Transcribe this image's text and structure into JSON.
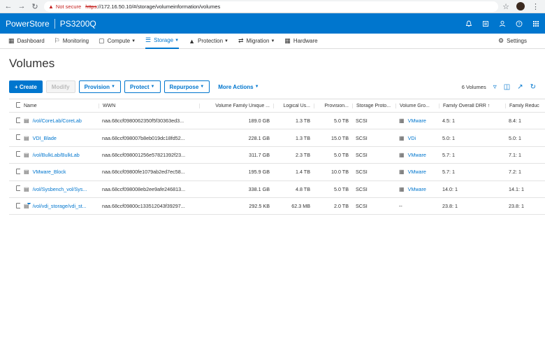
{
  "browser": {
    "not_secure": "Not secure",
    "url_scheme": "https",
    "url_rest": "://172.16.50.10/#/storage/volumeinformation/volumes"
  },
  "app": {
    "brand": "PowerStore",
    "system": "PS3200Q"
  },
  "nav": {
    "items": [
      {
        "label": "Dashboard",
        "icon": "dashboard-icon"
      },
      {
        "label": "Monitoring",
        "icon": "flag-icon"
      },
      {
        "label": "Compute",
        "icon": "compute-icon"
      },
      {
        "label": "Storage",
        "icon": "storage-icon"
      },
      {
        "label": "Protection",
        "icon": "shield-icon"
      },
      {
        "label": "Migration",
        "icon": "migration-icon"
      },
      {
        "label": "Hardware",
        "icon": "hardware-icon"
      }
    ],
    "settings": "Settings"
  },
  "page": {
    "title": "Volumes"
  },
  "toolbar": {
    "create": "+ Create",
    "modify": "Modify",
    "provision": "Provision",
    "protect": "Protect",
    "repurpose": "Repurpose",
    "more": "More Actions",
    "count": "6 Volumes"
  },
  "table": {
    "headers": {
      "name": "Name",
      "wwn": "WWN",
      "family": "Volume Family Unique ...",
      "logical": "Logical Us...",
      "provisioned": "Provision...",
      "protocol": "Storage Proto...",
      "group": "Volume Gro...",
      "drr": "Family Overall DRR",
      "fred": "Family Reduc"
    },
    "rows": [
      {
        "name": "/vol/CoreLab/CoreLab",
        "wwn": "naa.68ccf0980062350f5f30363ed3...",
        "family": "189.0 GB",
        "logical": "1.3 TB",
        "prov": "5.0 TB",
        "proto": "SCSI",
        "group": "VMware",
        "drr": "4.5: 1",
        "fred": "8.4: 1"
      },
      {
        "name": "VDI_Blade",
        "wwn": "naa.68ccf098007b8eb019dc18fd52...",
        "family": "228.1 GB",
        "logical": "1.3 TB",
        "prov": "15.0 TB",
        "proto": "SCSI",
        "group": "VDi",
        "drr": "5.0: 1",
        "fred": "5.0: 1"
      },
      {
        "name": "/vol/BulkLab/BulkLab",
        "wwn": "naa.68ccf098001256e57821392f23...",
        "family": "311.7 GB",
        "logical": "2.3 TB",
        "prov": "5.0 TB",
        "proto": "SCSI",
        "group": "VMware",
        "drr": "5.7: 1",
        "fred": "7.1: 1"
      },
      {
        "name": "VMware_Block",
        "wwn": "naa.68ccf09800fe1079ab2ed7ec58...",
        "family": "195.9 GB",
        "logical": "1.4 TB",
        "prov": "10.0 TB",
        "proto": "SCSI",
        "group": "VMware",
        "drr": "5.7: 1",
        "fred": "7.2: 1"
      },
      {
        "name": "/vol/Sysbench_vol/Sys...",
        "wwn": "naa.68ccf098008eb2ee9afe246813...",
        "family": "338.1 GB",
        "logical": "4.8 TB",
        "prov": "5.0 TB",
        "proto": "SCSI",
        "group": "VMware",
        "drr": "14.0: 1",
        "fred": "14.1: 1"
      },
      {
        "name": "/vol/vdi_storage/vdi_st...",
        "wwn": "naa.68ccf09800c133512043f39297...",
        "family": "292.5 KB",
        "logical": "62.3 MB",
        "prov": "2.0 TB",
        "proto": "SCSI",
        "group": "--",
        "drr": "23.8: 1",
        "fred": "23.8: 1"
      }
    ]
  },
  "colors": {
    "accent": "#0076ce"
  }
}
